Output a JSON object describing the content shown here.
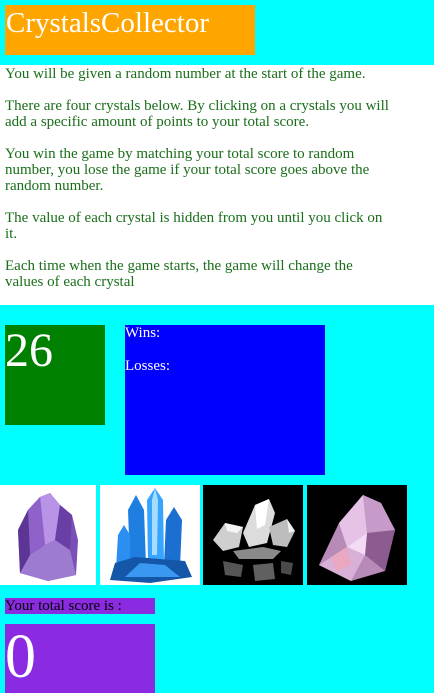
{
  "header": {
    "title": "CrystalsCollector"
  },
  "instructions": [
    "You will be given a random number at the start of the game.",
    "There are four crystals below. By clicking on a crystals you will add a specific amount of points to your total score.",
    "You win the game by matching your total score to random number, you lose the game if your total score goes above the random number.",
    "The value of each crystal is hidden from you until you click on it.",
    "Each time when the game starts, the game will change the values of each crystal"
  ],
  "game": {
    "random_number": "26",
    "wins_label": "Wins:",
    "losses_label": "Losses:",
    "score_label": "Your total score is :",
    "total_score": "0"
  },
  "crystals": [
    {
      "icon": "amethyst-crystal-icon",
      "color": "#9b6fd0",
      "background": "#ffffff"
    },
    {
      "icon": "blue-crystal-icon",
      "color": "#1e90ff",
      "background": "#ffffff"
    },
    {
      "icon": "clear-quartz-crystal-icon",
      "color": "#e0e0e0",
      "background": "#000000"
    },
    {
      "icon": "pink-quartz-crystal-icon",
      "color": "#d8a8d8",
      "background": "#000000"
    }
  ]
}
